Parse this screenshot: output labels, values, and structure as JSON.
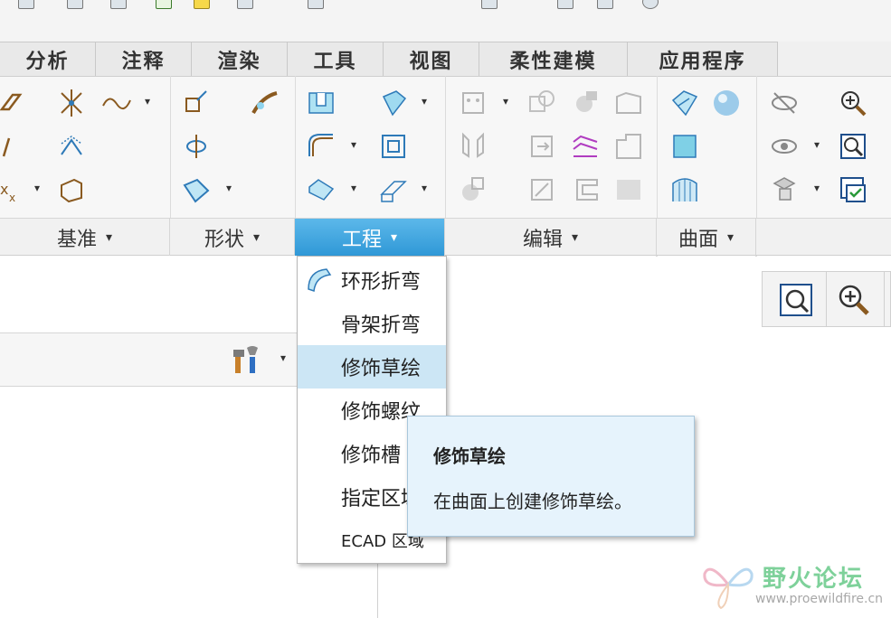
{
  "menu_tabs": [
    "分析",
    "注释",
    "渲染",
    "工具",
    "视图",
    "柔性建模",
    "应用程序"
  ],
  "ribbon_groups": {
    "datum": "基准",
    "shapes": "形状",
    "engineering": "工程",
    "editing": "编辑",
    "surfaces": "曲面"
  },
  "dropdown_arrow": "▾",
  "engineering_menu": {
    "items": [
      "环形折弯",
      "骨架折弯",
      "修饰草绘",
      "修饰螺纹",
      "修饰槽",
      "指定区域",
      "ECAD 区域"
    ],
    "highlighted": "修饰草绘"
  },
  "tooltip": {
    "title": "修饰草绘",
    "description": "在曲面上创建修饰草绘。"
  },
  "watermark": {
    "name": "野火论坛",
    "url": "www.proewildfire.cn"
  },
  "colors": {
    "active_group": "#2e97d6",
    "highlight": "#cce6f5",
    "tooltip_bg": "#e6f3fc",
    "watermark_green": "#7ed19a"
  }
}
